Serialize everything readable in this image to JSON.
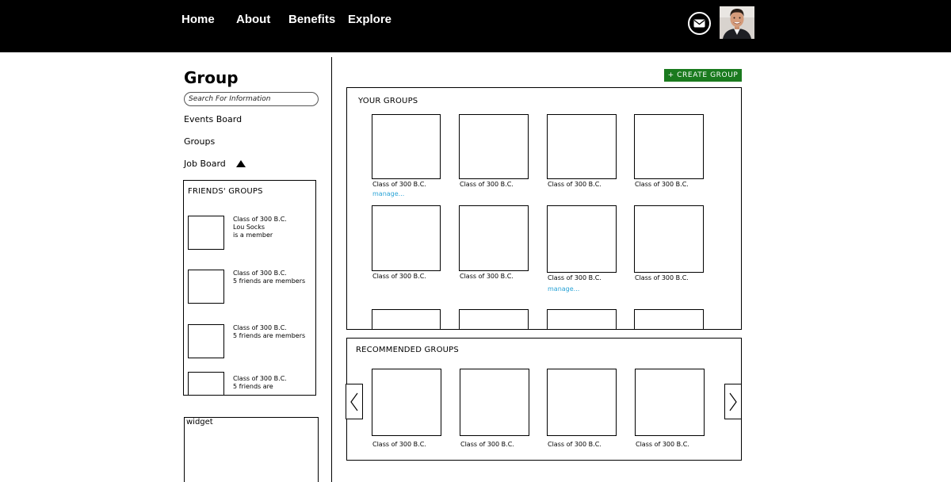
{
  "nav": {
    "items": [
      "Home",
      "About",
      "Benefits",
      "Explore"
    ],
    "mail_icon": "envelope-icon",
    "avatar_icon": "user-avatar-photo"
  },
  "sidebar": {
    "title": "Group",
    "search_placeholder": "Search For Information",
    "links": [
      "Events Board",
      "Groups",
      "Job Board"
    ],
    "job_board_icon": "triangle-up-icon",
    "friends_groups": {
      "title": "FRIENDS' GROUPS",
      "items": [
        {
          "lines": [
            "Class of 300 B.C.",
            "Lou Socks",
            "is a member"
          ]
        },
        {
          "lines": [
            "Class of 300 B.C.",
            "5 friends are members"
          ]
        },
        {
          "lines": [
            "Class of 300 B.C.",
            "5 friends are members"
          ]
        },
        {
          "lines": [
            "Class of 300 B.C.",
            "5 friends are"
          ]
        }
      ]
    },
    "widget_label": "widget"
  },
  "main": {
    "create_button": "+ CREATE GROUP",
    "your_groups": {
      "title": "YOUR GROUPS",
      "manage_label": "manage...",
      "tiles": [
        {
          "caption": "Class of 300 B.C.",
          "manage": true
        },
        {
          "caption": "Class of 300 B.C.",
          "manage": false
        },
        {
          "caption": "Class of 300 B.C.",
          "manage": false
        },
        {
          "caption": "Class of 300 B.C.",
          "manage": false
        },
        {
          "caption": "Class of 300 B.C.",
          "manage": false
        },
        {
          "caption": "Class of 300 B.C.",
          "manage": false
        },
        {
          "caption": "Class of 300 B.C.",
          "manage": true
        },
        {
          "caption": "Class of 300 B.C.",
          "manage": false
        }
      ]
    },
    "recommended_groups": {
      "title": "RECOMMENDED GROUPS",
      "tiles": [
        {
          "caption": "Class of 300 B.C."
        },
        {
          "caption": "Class of 300 B.C."
        },
        {
          "caption": "Class of 300 B.C."
        },
        {
          "caption": "Class of 300 B.C."
        }
      ],
      "prev_icon": "chevron-left-icon",
      "next_icon": "chevron-right-icon"
    }
  },
  "colors": {
    "topbar": "#000000",
    "create_button": "#1a7a1e",
    "manage_link": "#29a3d6"
  }
}
